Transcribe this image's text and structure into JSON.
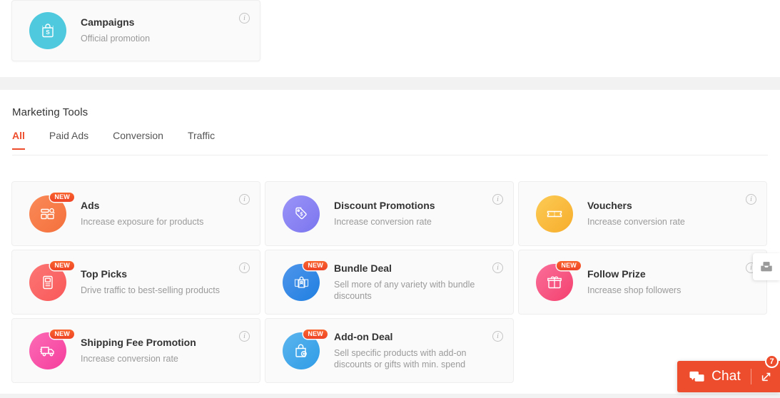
{
  "campaign_card": {
    "title": "Campaigns",
    "description": "Official promotion",
    "icon": "shopping-bag-s-icon",
    "color": "#4ec9dd",
    "info_icon": "i",
    "badge": null
  },
  "marketing_tools": {
    "heading": "Marketing Tools",
    "tabs": [
      {
        "label": "All",
        "active": true
      },
      {
        "label": "Paid Ads",
        "active": false
      },
      {
        "label": "Conversion",
        "active": false
      },
      {
        "label": "Traffic",
        "active": false
      }
    ],
    "active_tab_color": "#ee4d2d",
    "info_icon": "i",
    "new_badge_label": "NEW",
    "cards": [
      {
        "title": "Ads",
        "description": "Increase exposure for products",
        "icon": "ads-search-icon",
        "color": "#fa8050",
        "color_end": "#f4703c",
        "badge": "NEW"
      },
      {
        "title": "Discount Promotions",
        "description": "Increase conversion rate",
        "icon": "price-tag-dollar-icon",
        "color": "#8b85f5",
        "color_end": "#7b75ef",
        "badge": null
      },
      {
        "title": "Vouchers",
        "description": "Increase conversion rate",
        "icon": "ticket-icon",
        "color": "#fbc346",
        "color_end": "#f7b02f",
        "badge": null
      },
      {
        "title": "Top Picks",
        "description": "Drive traffic to best-selling products",
        "icon": "top-picks-board-icon",
        "color": "#fb6a6a",
        "color_end": "#f95858",
        "badge": "NEW"
      },
      {
        "title": "Bundle Deal",
        "description": "Sell more of any variety with bundle discounts",
        "icon": "bundle-bags-icon",
        "color": "#3b8ae8",
        "color_end": "#1f7fe0",
        "badge": "NEW"
      },
      {
        "title": "Follow Prize",
        "description": "Increase shop followers",
        "icon": "gift-icon",
        "color": "#f85c8c",
        "color_end": "#f4406f",
        "badge": "NEW"
      },
      {
        "title": "Shipping Fee Promotion",
        "description": "Increase conversion rate",
        "icon": "delivery-truck-icon",
        "color": "#fb53a9",
        "color_end": "#f53d9c",
        "badge": "NEW"
      },
      {
        "title": "Add-on Deal",
        "description": "Sell specific products with add-on discounts or gifts with min. spend",
        "icon": "bag-plus-icon",
        "color": "#46a9ea",
        "color_end": "#2f9ce6",
        "badge": "NEW"
      }
    ]
  },
  "inbox_widget": {
    "icon": "envelope-inbox-icon"
  },
  "chat_widget": {
    "label": "Chat",
    "icon": "chat-bubble-icon",
    "expand_icon": "expand-arrow-icon",
    "count": "7",
    "color": "#ee4d2d"
  }
}
